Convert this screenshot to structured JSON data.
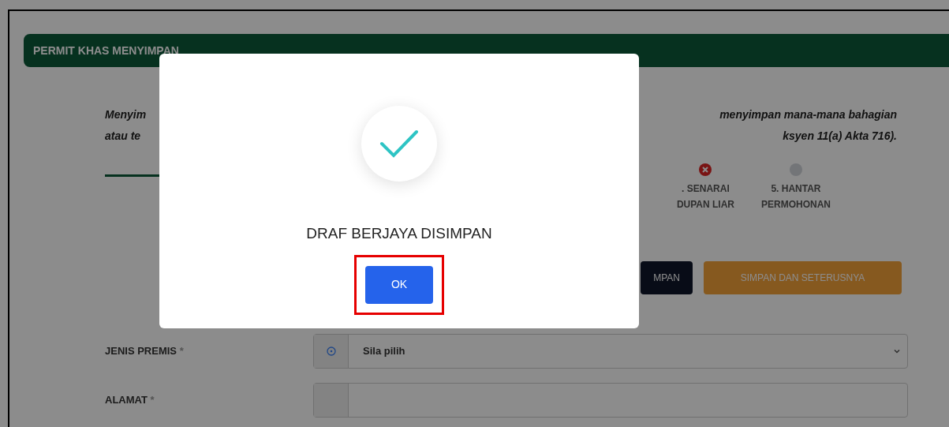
{
  "header": {
    "title": "PERMIT KHAS MENYIMPAN"
  },
  "intro": {
    "lines": [
      {
        "left": "Menyim",
        "right": "menyimpan mana-mana bahagian"
      },
      {
        "left": "atau te",
        "right": "ksyen 11(a) Akta 716)."
      }
    ]
  },
  "steps": [
    {
      "line1": ". SENARAI",
      "line2": "DUPAN LIAR",
      "kind": "error"
    },
    {
      "line1": "5. HANTAR",
      "line2": "PERMOHONAN",
      "kind": "pending"
    }
  ],
  "actions": [
    {
      "label": "MPAN",
      "kind": "dark"
    },
    {
      "label": "SIMPAN DAN SETERUSNYA",
      "kind": "orange"
    }
  ],
  "form": [
    {
      "label": "JENIS PREMIS",
      "required": "*",
      "kind": "select",
      "value": "Sila pilih"
    },
    {
      "label": "ALAMAT",
      "required": "*",
      "kind": "text"
    }
  ],
  "dialog": {
    "message": "DRAF BERJAYA DISIMPAN",
    "button": "OK",
    "highlighted": true
  }
}
